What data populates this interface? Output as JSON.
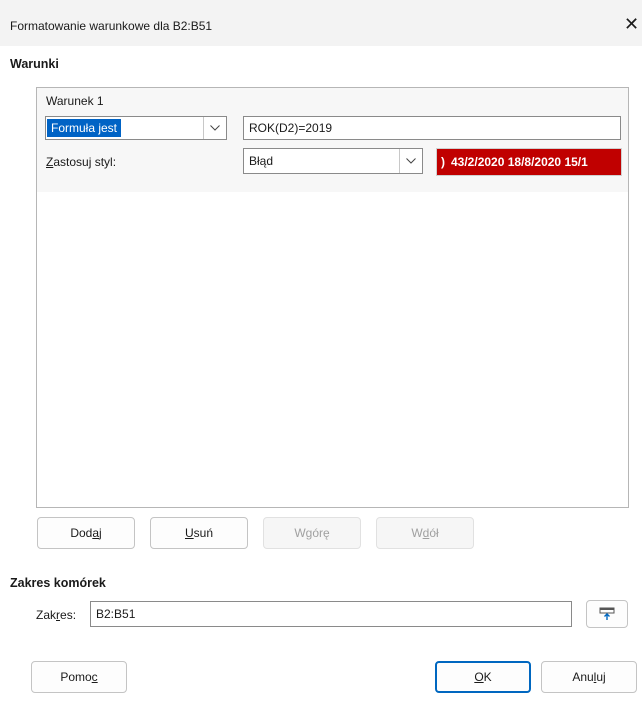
{
  "window": {
    "title": "Formatowanie warunkowe dla B2:B51",
    "close_glyph": "✕"
  },
  "conditions": {
    "section_label": "Warunki",
    "condition_title": "Warunek 1",
    "type_value": "Formuła jest",
    "formula_value": "ROK(D2)=2019",
    "apply_style_label": "Zastosuj styl:",
    "style_value": "Błąd",
    "preview_text": "43/2/2020 18/8/2020 15/1",
    "preview_color": "#c00000"
  },
  "buttons": {
    "add": "Dodaj",
    "remove": "Usuń",
    "up": "W górę",
    "down": "W dół"
  },
  "range": {
    "section_label": "Zakres komórek",
    "label": "Zakres:",
    "value": "B2:B51",
    "picker_icon": "shrink-icon"
  },
  "footer": {
    "help": "Pomoc",
    "ok": "OK",
    "cancel": "Anuluj"
  },
  "colors": {
    "accent": "#0067c0",
    "selection": "#0063c5"
  }
}
